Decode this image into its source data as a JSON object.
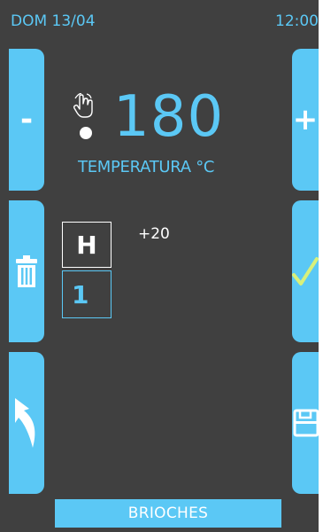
{
  "status_bar": {
    "date": "DOM 13/04",
    "time": "12:00"
  },
  "buttons": {
    "decrease_label": "-",
    "increase_label": "+",
    "delete_icon": "trash-icon",
    "confirm_icon": "checkmark-icon",
    "back_icon": "back-arrow-icon",
    "save_icon": "floppy-disk-icon"
  },
  "temperature": {
    "value": "180",
    "label": "TEMPERATURA °C",
    "touch_icon": "touch-hand-icon"
  },
  "program": {
    "mode": "H",
    "step": "1",
    "offset": "+20"
  },
  "recipe": {
    "name": "BRIOCHES"
  },
  "colors": {
    "background": "#404040",
    "accent": "#5bc8f5",
    "text": "#ffffff",
    "check": "#d8f07a"
  }
}
